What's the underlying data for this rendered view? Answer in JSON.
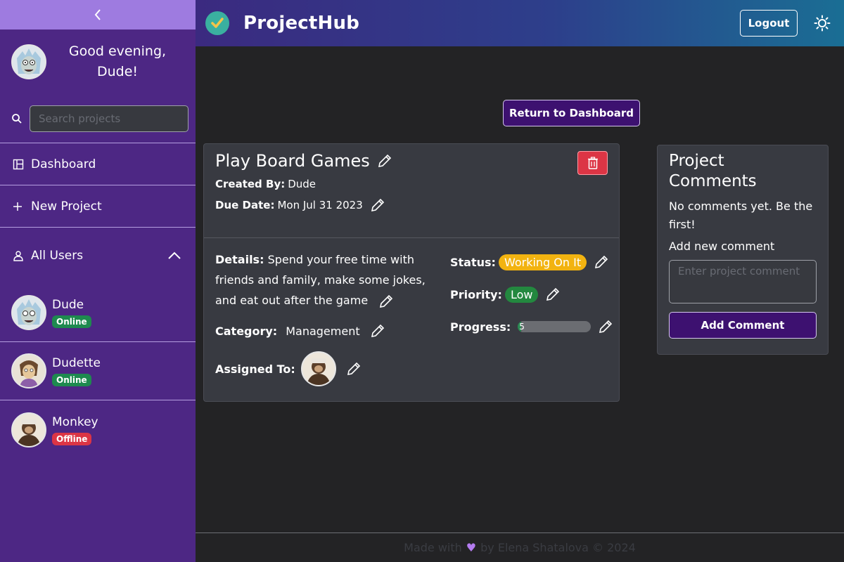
{
  "app": {
    "name": "ProjectHub"
  },
  "header": {
    "logout_label": "Logout",
    "icons": [
      "check-logo-icon",
      "sun-icon"
    ]
  },
  "sidebar": {
    "greeting": "Good evening, Dude!",
    "search_placeholder": "Search projects",
    "nav": [
      {
        "label": "Dashboard",
        "icon": "dashboard-icon"
      },
      {
        "label": "New Project",
        "icon": "plus-icon"
      }
    ],
    "users_header": "All Users",
    "users": [
      {
        "name": "Dude",
        "status": "Online"
      },
      {
        "name": "Dudette",
        "status": "Online"
      },
      {
        "name": "Monkey",
        "status": "Offline"
      }
    ]
  },
  "main": {
    "return_label": "Return to Dashboard",
    "project": {
      "title": "Play Board Games",
      "created_by_label": "Created By:",
      "created_by": "Dude",
      "due_date_label": "Due Date:",
      "due_date": "Mon Jul 31 2023",
      "details_label": "Details:",
      "details": "Spend your free time with friends and family, make some jokes, and eat out after the game",
      "category_label": "Category:",
      "category": "Management",
      "assigned_label": "Assigned To:",
      "status_label": "Status:",
      "status": "Working On It",
      "priority_label": "Priority:",
      "priority": "Low",
      "progress_label": "Progress:",
      "progress_value": "5",
      "progress_percent": 5
    },
    "comments": {
      "title": "Project Comments",
      "empty_text": "No comments yet. Be the first!",
      "add_label": "Add new comment",
      "input_placeholder": "Enter project comment",
      "add_button": "Add Comment"
    }
  },
  "footer": {
    "made_with": "Made with",
    "by": "by Elena Shatalova © 2024"
  },
  "colors": {
    "sidebar": "#4d2784",
    "accent": "#9e7be0",
    "online": "#1e8a4f",
    "offline": "#dc3545",
    "status": "#f2b310",
    "priority": "#23883f"
  }
}
